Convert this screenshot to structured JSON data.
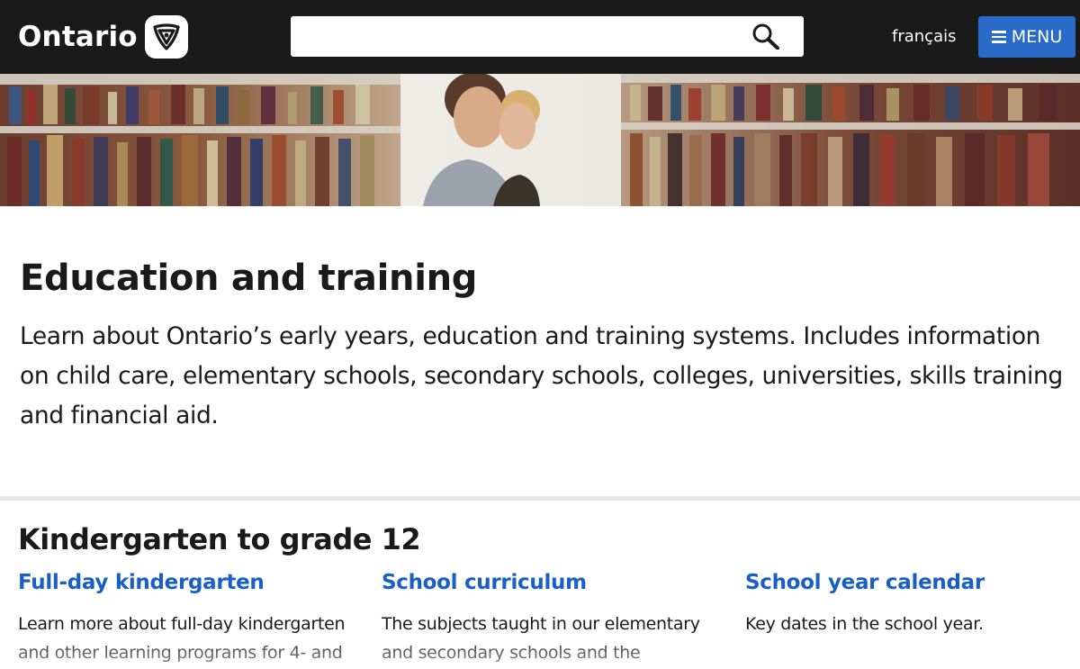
{
  "header": {
    "logo_text": "Ontario",
    "logo_icon": "trillium-icon",
    "search": {
      "value": "",
      "placeholder": "",
      "button_icon": "search-icon"
    },
    "language_link": "français",
    "menu_label": "MENU",
    "menu_icon": "hamburger-icon",
    "menu_color": "#2a6ac8"
  },
  "hero": {
    "image": "people-in-library-stacks-photo"
  },
  "main": {
    "title": "Education and training",
    "intro": "Learn about Ontario’s early years, education and training systems. Includes information on child care, elementary schools, secondary schools, colleges, universities, skills training and financial aid."
  },
  "section": {
    "heading": "Kindergarten to grade 12",
    "link_color": "#1a5fc4",
    "cards": [
      {
        "title": "Full-day kindergarten",
        "description": "Learn more about full-day kindergarten and other learning programs for 4- and"
      },
      {
        "title": "School curriculum",
        "description": "The subjects taught in our elementary and secondary schools and the"
      },
      {
        "title": "School year calendar",
        "description": "Key dates in the school year."
      }
    ]
  }
}
